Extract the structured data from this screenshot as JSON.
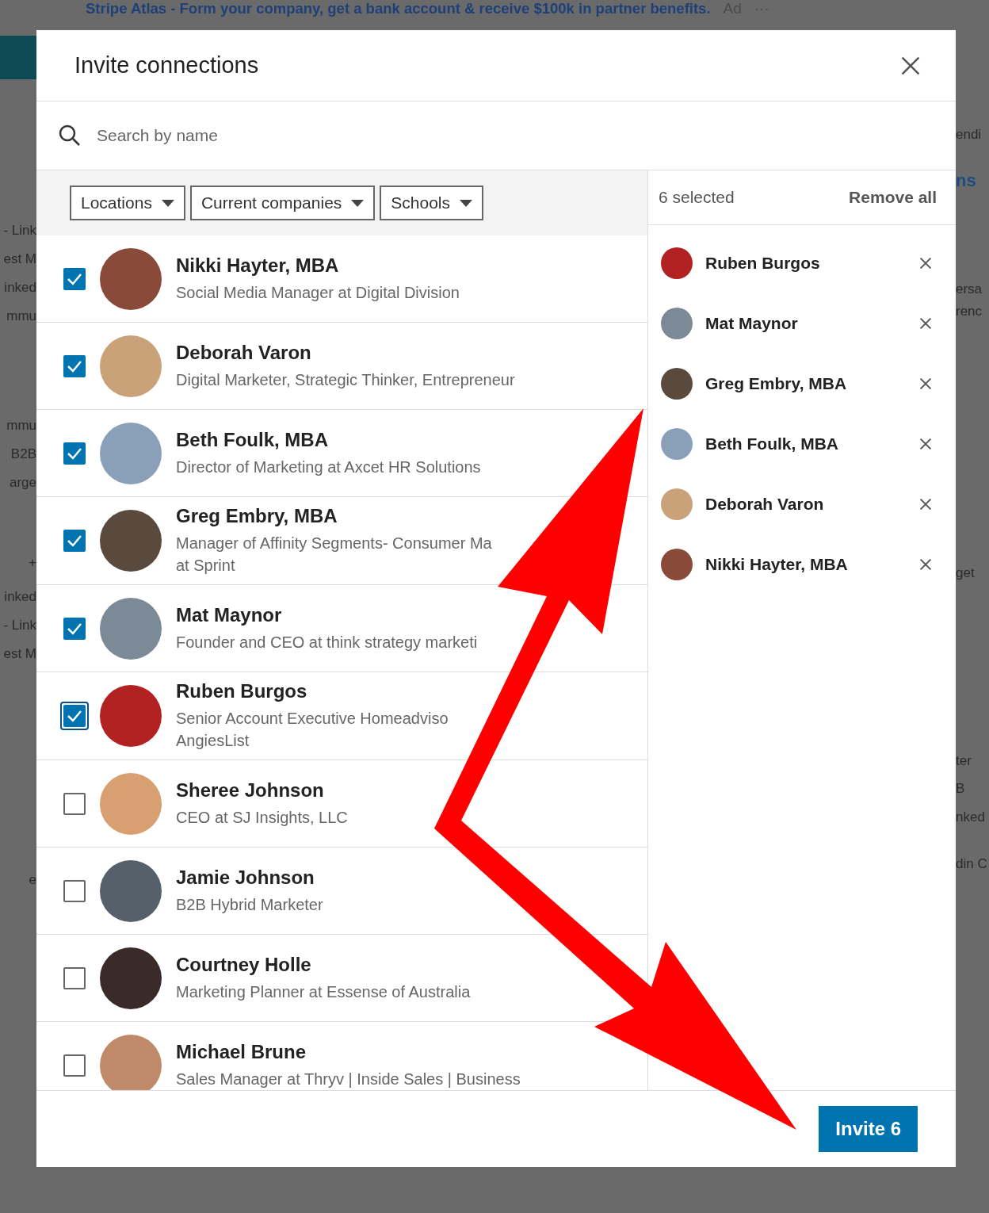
{
  "background": {
    "banner": {
      "text": "Stripe Atlas - Form your company, get a bank account & receive $100k in partner benefits.",
      "ad": "Ad",
      "more": "···"
    },
    "left_fragments": [
      "- Link",
      "est M",
      "inked",
      "mmu",
      "mmu",
      "B2B",
      "arge",
      "+",
      "inked",
      "- Link",
      "est M",
      "e"
    ],
    "right_fragments": [
      "endi",
      "ns",
      "ersa",
      "renc",
      "get",
      "ter",
      "B",
      "nked",
      "din C"
    ]
  },
  "modal": {
    "title": "Invite connections",
    "search": {
      "placeholder": "Search by name"
    },
    "filters": [
      "Locations",
      "Current companies",
      "Schools"
    ],
    "people": [
      {
        "name": "Nikki Hayter, MBA",
        "lines": [
          "Social Media Manager at Digital Division"
        ],
        "checked": true,
        "focused": false,
        "color": "#8a4a3a"
      },
      {
        "name": "Deborah Varon",
        "lines": [
          "Digital Marketer, Strategic Thinker, Entrepreneur"
        ],
        "checked": true,
        "focused": false,
        "color": "#c9a27a"
      },
      {
        "name": "Beth Foulk, MBA",
        "lines": [
          "Director of Marketing at Axcet HR Solutions"
        ],
        "checked": true,
        "focused": false,
        "color": "#8aa0b8"
      },
      {
        "name": "Greg Embry, MBA",
        "lines": [
          "Manager of Affinity Segments- Consumer Ma",
          "at Sprint"
        ],
        "checked": true,
        "focused": false,
        "color": "#5a4a3e"
      },
      {
        "name": "Mat Maynor",
        "lines": [
          "Founder and CEO at think strategy marketi"
        ],
        "checked": true,
        "focused": false,
        "color": "#7c8a98"
      },
      {
        "name": "Ruben Burgos",
        "lines": [
          "Senior Account Executive Homeadviso",
          "AngiesList"
        ],
        "checked": true,
        "focused": true,
        "color": "#b22222"
      },
      {
        "name": "Sheree Johnson",
        "lines": [
          "CEO at SJ Insights, LLC"
        ],
        "checked": false,
        "focused": false,
        "color": "#d8a070"
      },
      {
        "name": "Jamie Johnson",
        "lines": [
          "B2B Hybrid Marketer"
        ],
        "checked": false,
        "focused": false,
        "color": "#55606a"
      },
      {
        "name": "Courtney Holle",
        "lines": [
          "Marketing Planner at Essense of Australia"
        ],
        "checked": false,
        "focused": false,
        "color": "#3a2a2a"
      },
      {
        "name": "Michael Brune",
        "lines": [
          "Sales Manager at Thryv | Inside Sales | Business"
        ],
        "checked": false,
        "focused": false,
        "color": "#c08a6a"
      }
    ],
    "selected_count": "6 selected",
    "remove_all": "Remove all",
    "selected": [
      {
        "name": "Ruben Burgos",
        "color": "#b22222"
      },
      {
        "name": "Mat Maynor",
        "color": "#7c8a98"
      },
      {
        "name": "Greg Embry, MBA",
        "color": "#5a4a3e"
      },
      {
        "name": "Beth Foulk, MBA",
        "color": "#8aa0b8"
      },
      {
        "name": "Deborah Varon",
        "color": "#c9a27a"
      },
      {
        "name": "Nikki Hayter, MBA",
        "color": "#8a4a3a"
      }
    ],
    "invite_button": "Invite 6"
  }
}
